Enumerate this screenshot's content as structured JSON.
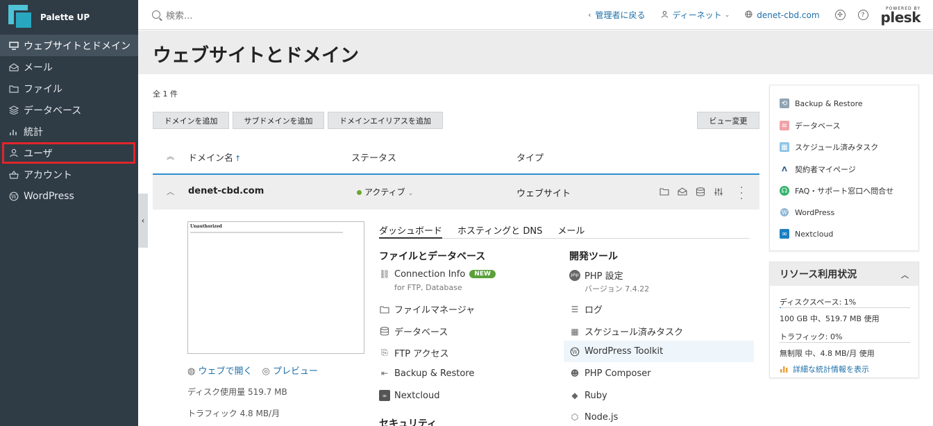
{
  "app": {
    "name": "Palette UP"
  },
  "sidebar": {
    "items": [
      {
        "label": "ウェブサイトとドメイン",
        "icon": "monitor-icon",
        "active": true
      },
      {
        "label": "メール",
        "icon": "mail-icon"
      },
      {
        "label": "ファイル",
        "icon": "folder-icon"
      },
      {
        "label": "データベース",
        "icon": "database-icon"
      },
      {
        "label": "統計",
        "icon": "bar-chart-icon"
      },
      {
        "label": "ユーザ",
        "icon": "user-icon",
        "highlighted": true
      },
      {
        "label": "アカウント",
        "icon": "account-icon"
      },
      {
        "label": "WordPress",
        "icon": "wordpress-icon"
      }
    ]
  },
  "topbar": {
    "search_placeholder": "検索...",
    "back_to_admin": "管理者に戻る",
    "user": "ディーネット",
    "domain": "denet-cbd.com",
    "powered_by": "POWERED BY",
    "brand": "plesk"
  },
  "page": {
    "title": "ウェブサイトとドメイン",
    "count": "全 1 件"
  },
  "buttons": {
    "add_domain": "ドメインを追加",
    "add_subdomain": "サブドメインを追加",
    "add_alias": "ドメインエイリアスを追加",
    "change_view": "ビュー変更"
  },
  "table": {
    "col_domain": "ドメイン名",
    "col_status": "ステータス",
    "col_type": "タイプ",
    "row": {
      "domain": "denet-cbd.com",
      "status": "アクティブ",
      "type": "ウェブサイト"
    }
  },
  "preview": {
    "title": "Unauthorized",
    "open_web": "ウェブで開く",
    "preview": "プレビュー",
    "disk_usage": "ディスク使用量 519.7 MB",
    "traffic": "トラフィック 4.8 MB/月"
  },
  "tabs": [
    "ダッシュボード",
    "ホスティングと DNS",
    "メール"
  ],
  "files_section": {
    "heading": "ファイルとデータベース",
    "connection_info": "Connection Info",
    "new_badge": "NEW",
    "connection_sub": "for FTP, Database",
    "file_manager": "ファイルマネージャ",
    "databases": "データベース",
    "ftp": "FTP アクセス",
    "backup": "Backup & Restore",
    "nextcloud": "Nextcloud",
    "security_heading": "セキュリティ"
  },
  "dev_section": {
    "heading": "開発ツール",
    "php": "PHP 設定",
    "php_version": "バージョン 7.4.22",
    "logs": "ログ",
    "scheduled": "スケジュール済みタスク",
    "wp_toolkit": "WordPress Toolkit",
    "composer": "PHP Composer",
    "ruby": "Ruby",
    "node": "Node.js"
  },
  "side_links": [
    "Backup & Restore",
    "データベース",
    "スケジュール済みタスク",
    "契約者マイページ",
    "FAQ・サポート窓口へ問合せ",
    "WordPress",
    "Nextcloud"
  ],
  "resources": {
    "title": "リソース利用状況",
    "disk_label": "ディスクスペース: 1%",
    "disk_fraction": 0.01,
    "disk_detail": "100 GB 中、519.7 MB 使用",
    "traffic_label": "トラフィック: 0%",
    "traffic_fraction": 0,
    "traffic_detail": "無制限 中、4.8 MB/月 使用",
    "stats_link": "詳細な統計情報を表示"
  }
}
